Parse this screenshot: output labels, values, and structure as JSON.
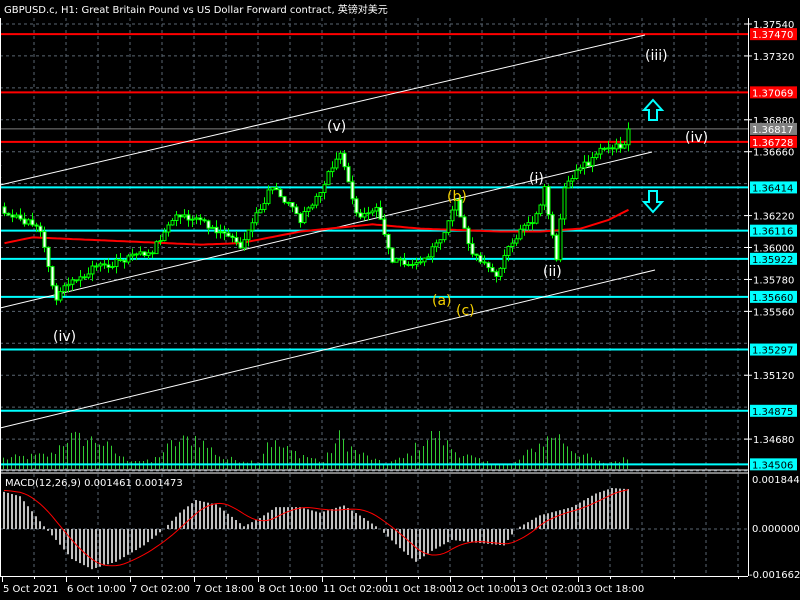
{
  "title": "GBPUSD.c, H1:  Great Britain Pound vs US Dollar Forward contract, 英镑对美元",
  "colors": {
    "background": "#000000",
    "bull_candle": "#00ff00",
    "bear_body": "#ffffff",
    "resistance": "#ff0000",
    "support": "#00ffff",
    "bid_line": "#808080",
    "ma": "#ff0000",
    "volume": "#32cd32",
    "macd_hist": "#c0c0c0",
    "macd_signal": "#ff0000",
    "wave_white": "#ffffff",
    "wave_yellow": "#f4d000",
    "arrow": "#00ffff"
  },
  "chart_data": {
    "type": "candlestick",
    "symbol": "GBPUSD.c",
    "timeframe": "H1",
    "price_range": [
      1.3446,
      1.3754
    ],
    "grid_ticks": [
      1.3754,
      1.3732,
      1.371,
      1.3688,
      1.3666,
      1.3644,
      1.3622,
      1.36,
      1.3578,
      1.3556,
      1.3534,
      1.3512,
      1.349,
      1.3468,
      1.3446
    ],
    "price_labels": [
      "1.37540",
      "1.37320",
      "1.36880",
      "1.36660",
      "1.36220",
      "1.36000",
      "1.35780",
      "1.35560",
      "1.35120",
      "1.34680"
    ],
    "levels": [
      {
        "price": "1.37470",
        "kind": "resistance"
      },
      {
        "price": "1.37069",
        "kind": "resistance"
      },
      {
        "price": "1.36728",
        "kind": "resistance"
      },
      {
        "price": "1.36414",
        "kind": "support"
      },
      {
        "price": "1.36116",
        "kind": "support"
      },
      {
        "price": "1.35922",
        "kind": "support"
      },
      {
        "price": "1.35660",
        "kind": "support"
      },
      {
        "price": "1.35297",
        "kind": "support"
      },
      {
        "price": "1.34875",
        "kind": "support"
      },
      {
        "price": "1.34506",
        "kind": "support"
      }
    ],
    "bid": "1.36817",
    "candle_count": 157,
    "close_waypoints": [
      [
        0,
        1.3626
      ],
      [
        9,
        1.3612
      ],
      [
        13,
        1.3564
      ],
      [
        15,
        1.3574
      ],
      [
        22,
        1.3585
      ],
      [
        29,
        1.3591
      ],
      [
        37,
        1.3598
      ],
      [
        43,
        1.3622
      ],
      [
        49,
        1.3619
      ],
      [
        59,
        1.3602
      ],
      [
        67,
        1.3643
      ],
      [
        74,
        1.3619
      ],
      [
        79,
        1.364
      ],
      [
        84,
        1.3667
      ],
      [
        88,
        1.3622
      ],
      [
        93,
        1.3626
      ],
      [
        97,
        1.3591
      ],
      [
        104,
        1.3588
      ],
      [
        109,
        1.3605
      ],
      [
        113,
        1.3633
      ],
      [
        117,
        1.3595
      ],
      [
        123,
        1.3581
      ],
      [
        127,
        1.3605
      ],
      [
        133,
        1.3622
      ],
      [
        135,
        1.364
      ],
      [
        138,
        1.3592
      ],
      [
        140,
        1.3643
      ],
      [
        144,
        1.3654
      ],
      [
        149,
        1.3666
      ],
      [
        155,
        1.3671
      ],
      [
        156,
        1.3682
      ]
    ],
    "ma_waypoints": [
      [
        0,
        1.3603
      ],
      [
        7,
        1.3607
      ],
      [
        24,
        1.3605
      ],
      [
        49,
        1.3602
      ],
      [
        59,
        1.3603
      ],
      [
        74,
        1.3611
      ],
      [
        92,
        1.3616
      ],
      [
        104,
        1.3613
      ],
      [
        124,
        1.3611
      ],
      [
        134,
        1.3611
      ],
      [
        144,
        1.3613
      ],
      [
        151,
        1.3619
      ],
      [
        156,
        1.3626
      ]
    ],
    "volume_profile": [
      [
        0,
        0.3
      ],
      [
        12,
        0.4
      ],
      [
        16,
        0.9
      ],
      [
        24,
        0.8
      ],
      [
        30,
        0.3
      ],
      [
        37,
        0.2
      ],
      [
        42,
        0.7
      ],
      [
        48,
        0.9
      ],
      [
        55,
        0.3
      ],
      [
        64,
        0.2
      ],
      [
        66,
        0.8
      ],
      [
        72,
        0.5
      ],
      [
        80,
        0.2
      ],
      [
        84,
        0.9
      ],
      [
        88,
        0.5
      ],
      [
        95,
        0.15
      ],
      [
        100,
        0.3
      ],
      [
        104,
        0.7
      ],
      [
        108,
        1.0
      ],
      [
        113,
        0.5
      ],
      [
        120,
        0.2
      ],
      [
        127,
        0.1
      ],
      [
        134,
        0.7
      ],
      [
        138,
        1.0
      ],
      [
        143,
        0.5
      ],
      [
        150,
        0.15
      ],
      [
        156,
        0.3
      ]
    ],
    "x_labels": [
      "5 Oct 2021",
      "6 Oct 10:00",
      "7 Oct 02:00",
      "7 Oct 18:00",
      "8 Oct 10:00",
      "11 Oct 02:00",
      "11 Oct 18:00",
      "12 Oct 10:00",
      "13 Oct 02:00",
      "13 Oct 18:00"
    ],
    "wave_labels": [
      "(iii)",
      "(iv)",
      "(v)",
      "(iv)",
      "(i)",
      "(ii)",
      "(a)",
      "(b)",
      "(c)",
      "("
    ],
    "macd": {
      "label": "MACD(12,26,9)",
      "value": "0.001461",
      "signal_value": "0.001473",
      "axis_labels": [
        "0.001844",
        "0.000000",
        "-0.001662"
      ],
      "range": [
        -0.001662,
        0.001844
      ],
      "hist_waypoints": [
        [
          0,
          0.00136
        ],
        [
          4,
          0.0012
        ],
        [
          10,
          0.0001
        ],
        [
          13,
          -0.0004
        ],
        [
          17,
          -0.0011
        ],
        [
          22,
          -0.00147
        ],
        [
          28,
          -0.0012
        ],
        [
          35,
          -0.0006
        ],
        [
          40,
          0.0
        ],
        [
          44,
          0.0006
        ],
        [
          48,
          0.00106
        ],
        [
          53,
          0.0009
        ],
        [
          60,
          0.0001
        ],
        [
          64,
          0.0004
        ],
        [
          68,
          0.0008
        ],
        [
          74,
          0.0008
        ],
        [
          79,
          0.0006
        ],
        [
          85,
          0.00086
        ],
        [
          90,
          0.0004
        ],
        [
          94,
          0.0
        ],
        [
          99,
          -0.0007
        ],
        [
          103,
          -0.0012
        ],
        [
          107,
          -0.0008
        ],
        [
          112,
          -0.0004
        ],
        [
          118,
          -0.0005
        ],
        [
          125,
          -0.0006
        ],
        [
          128,
          0.0
        ],
        [
          134,
          0.0005
        ],
        [
          142,
          0.0008
        ],
        [
          148,
          0.0013
        ],
        [
          152,
          0.0015
        ],
        [
          156,
          0.00146
        ]
      ]
    }
  }
}
